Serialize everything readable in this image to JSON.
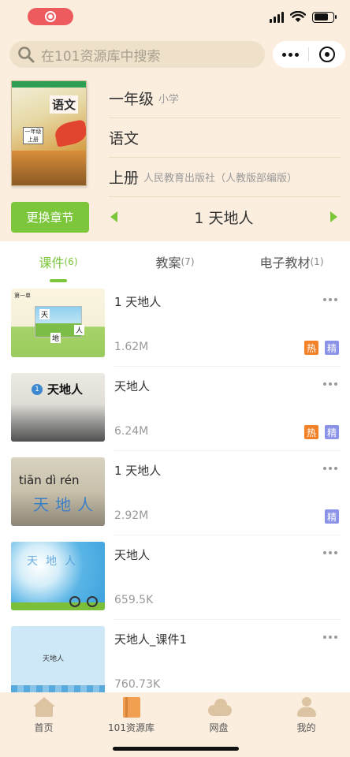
{
  "search": {
    "placeholder": "在101资源库中搜索"
  },
  "book": {
    "grade": "一年级",
    "stage": "小学",
    "subject": "语文",
    "volume": "上册",
    "publisher": "人民教育出版社（人教版部编版）",
    "cover": {
      "title": "语文",
      "label": "一年级 上册"
    }
  },
  "change_chapter_label": "更换章节",
  "chapter": {
    "current": "1 天地人"
  },
  "tabs": [
    {
      "label": "课件",
      "count": "(6)",
      "active": true
    },
    {
      "label": "教案",
      "count": "(7)",
      "active": false
    },
    {
      "label": "电子教材",
      "count": "(1)",
      "active": false
    }
  ],
  "items": [
    {
      "title": "1 天地人",
      "size": "1.62M",
      "hot": "热",
      "fine": "精",
      "thumb": {
        "head": "第一单",
        "tian": "天",
        "di": "地",
        "ren": "人"
      }
    },
    {
      "title": "天地人",
      "size": "6.24M",
      "hot": "热",
      "fine": "精",
      "thumb": {
        "num": "1",
        "text": "天地人"
      }
    },
    {
      "title": "1 天地人",
      "size": "2.92M",
      "fine": "精",
      "thumb": {
        "pinyin": "tiān dì rén",
        "text": "天地人"
      }
    },
    {
      "title": "天地人",
      "size": "659.5K",
      "thumb": {
        "text": "天地人"
      }
    },
    {
      "title": "天地人_课件1",
      "size": "760.73K",
      "thumb": {
        "text": "天地人"
      }
    }
  ],
  "tabbar": [
    {
      "label": "首页",
      "icon": "home-icon"
    },
    {
      "label": "101资源库",
      "icon": "book-icon",
      "active": true
    },
    {
      "label": "网盘",
      "icon": "cloud-icon"
    },
    {
      "label": "我的",
      "icon": "user-icon"
    }
  ],
  "colors": {
    "accent": "#7cc63c",
    "header_bg": "#fbeede",
    "hot": "#f28128",
    "fine": "#8b93e8"
  }
}
